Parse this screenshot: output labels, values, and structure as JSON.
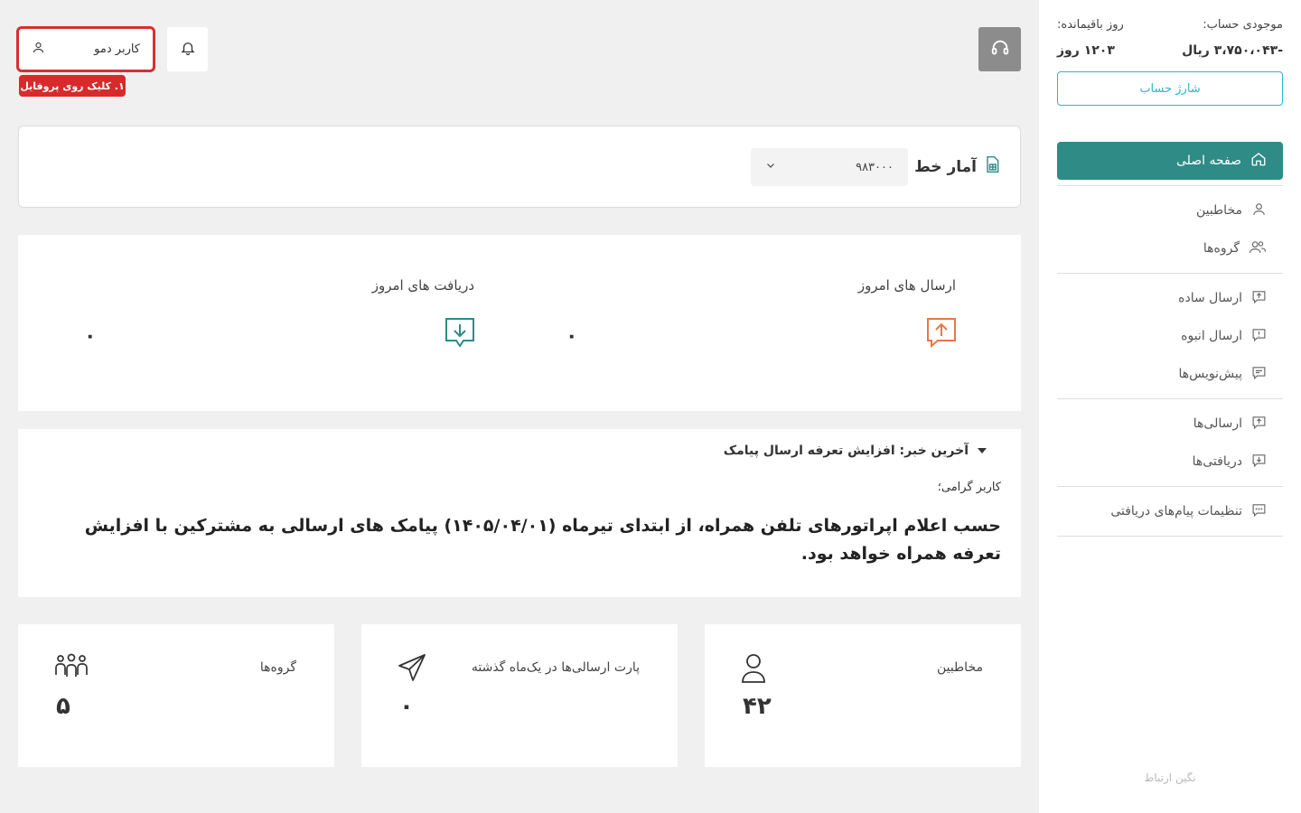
{
  "sidebar": {
    "balance_label": "موجودی حساب:",
    "balance_value": "-۳،۷۵۰،۰۴۳ ریال",
    "days_label": "روز باقیمانده:",
    "days_value": "۱۲۰۳ روز",
    "charge_button": "شارژ حساب",
    "home": "صفحه اصلی",
    "menu_groups": [
      [
        "مخاطبین",
        "گروه‌ها"
      ],
      [
        "ارسال ساده",
        "ارسال انبوه",
        "پیش‌نویس‌ها"
      ],
      [
        "ارسالی‌ها",
        "دریافتی‌ها"
      ],
      [
        "تنظیمات پیام‌های دریافتی"
      ]
    ],
    "footer": "نگین ارتباط"
  },
  "header": {
    "user_name": "کاربر دمو",
    "tip": "۱. کلیک روی پروفایل"
  },
  "line_stats": {
    "title": "آمار خط",
    "selected_line": "۹۸۳۰۰۰"
  },
  "today": {
    "sent_label": "ارسال های امروز",
    "sent_value": "۰",
    "received_label": "دریافت های امروز",
    "received_value": "۰"
  },
  "news": {
    "title": "آخرین خبر: افزایش تعرفه ارسال پیامک",
    "greeting": "کاربر گرامی؛",
    "body": "حسب اعلام اپراتورهای تلفن همراه، از ابتدای تیرماه (۱۴۰۵/۰۴/۰۱) پیامک های ارسالی به مشترکین با افزایش تعرفه همراه خواهد بود."
  },
  "stats": {
    "contacts_label": "مخاطبین",
    "contacts_value": "۴۲",
    "parts_label": "پارت ارسالی‌ها در یک‌ماه گذشته",
    "parts_value": "۰",
    "groups_label": "گروه‌ها",
    "groups_value": "۵"
  },
  "colors": {
    "accent": "#2e8b85",
    "charge": "#2ab8c6",
    "sent_icon": "#e8774a",
    "received_icon": "#2e8b85",
    "tip": "#d82a2a"
  }
}
